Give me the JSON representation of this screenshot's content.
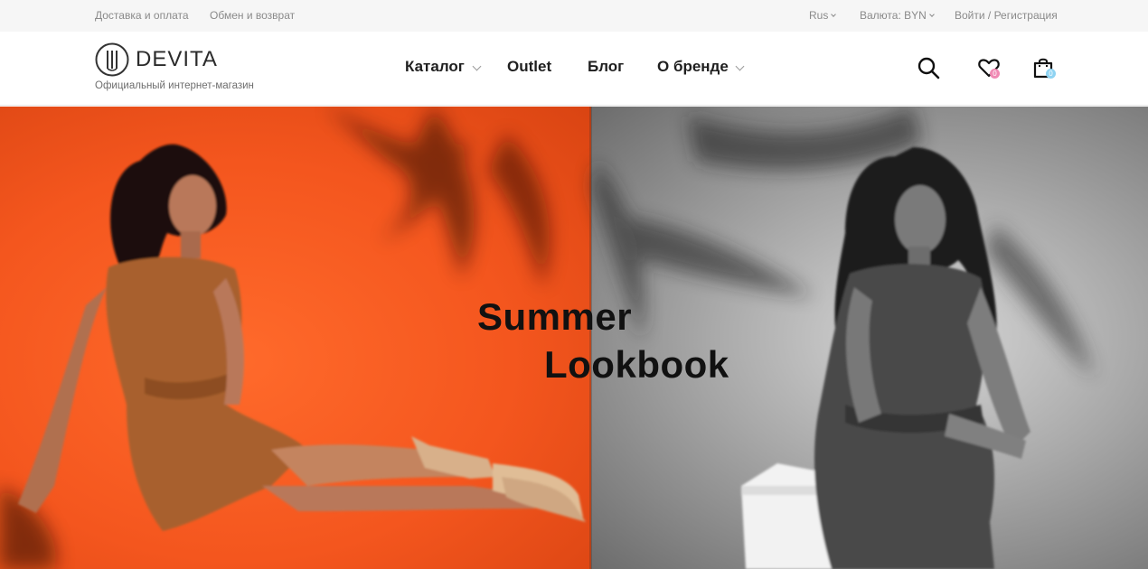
{
  "topbar": {
    "delivery": "Доставка  и оплата",
    "returns": "Обмен и возврат",
    "language": "Rus",
    "currency": "Валюта: BYN",
    "login": "Войти / Регистрация"
  },
  "header": {
    "logo_text": "DEVITA",
    "logo_subtitle": "Официальный интернет-магазин",
    "nav": {
      "catalog": "Каталог",
      "outlet": "Outlet",
      "blog": "Блог",
      "about": "О бренде"
    },
    "wishlist_count": "0",
    "cart_count": "0"
  },
  "colors": {
    "accent_pink": "#f08ab4",
    "accent_blue": "#8fd3f2",
    "hero_orange": "#f4561e"
  },
  "icons": {
    "logo": "devita-logo-icon",
    "search": "search-icon",
    "wishlist": "heart-icon",
    "cart": "shopping-bag-icon"
  },
  "hero": {
    "title_line1": "Summer",
    "title_line2": "Lookbook"
  }
}
